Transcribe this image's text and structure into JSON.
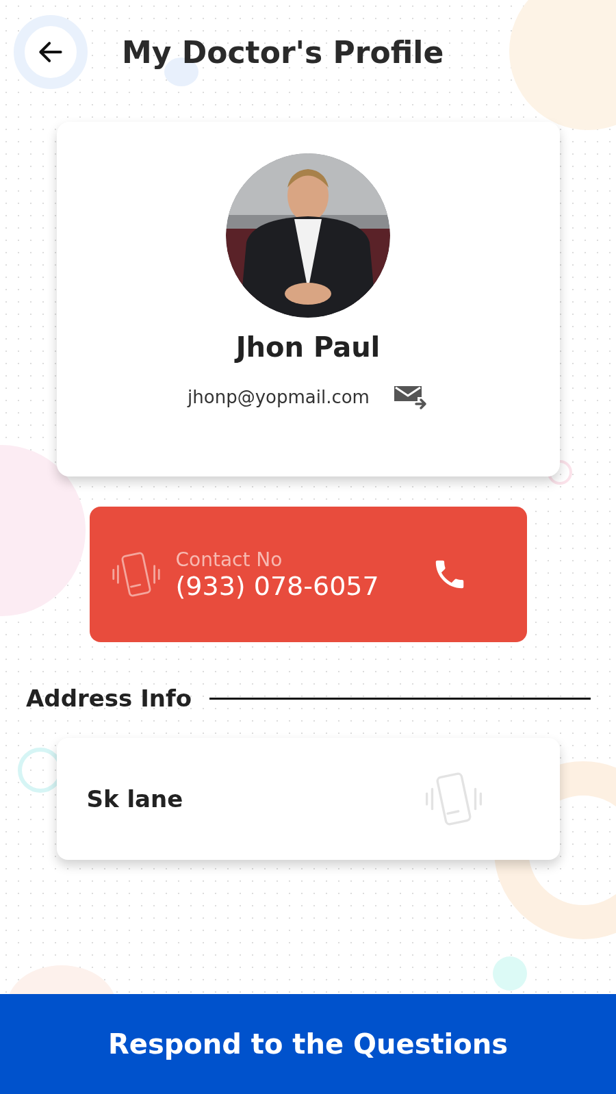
{
  "header": {
    "title": "My Doctor's Profile"
  },
  "doctor": {
    "name": "Jhon Paul",
    "email": "jhonp@yopmail.com"
  },
  "contact": {
    "label": "Contact No",
    "number": "(933) 078-6057"
  },
  "address": {
    "heading": "Address Info",
    "line": "Sk lane"
  },
  "action_button": {
    "label": "Respond to the Questions"
  }
}
